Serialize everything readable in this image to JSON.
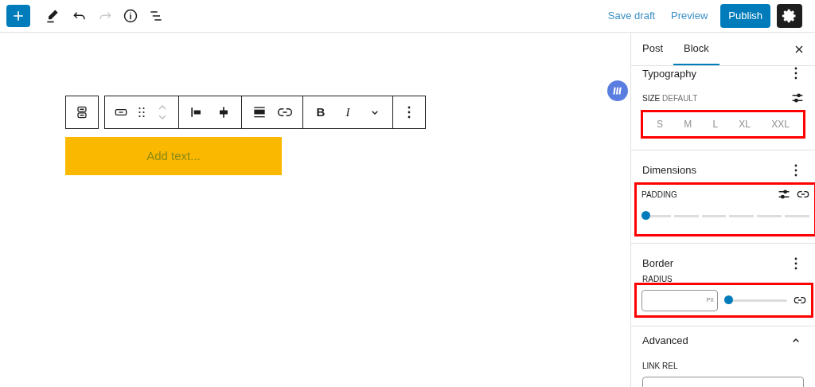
{
  "toolbar": {
    "save_draft": "Save draft",
    "preview": "Preview",
    "publish": "Publish",
    "redo_disabled": true
  },
  "editor": {
    "text_placeholder": "Add text..."
  },
  "block_toolbar": {
    "bold": "B",
    "italic": "I"
  },
  "sidebar": {
    "tabs": [
      {
        "label": "Post",
        "selected": false
      },
      {
        "label": "Block",
        "selected": true
      }
    ],
    "typography": {
      "title": "Typography",
      "size_label": "SIZE",
      "size_value": "DEFAULT",
      "sizes": [
        {
          "label": "S",
          "selected": false
        },
        {
          "label": "M",
          "selected": false
        },
        {
          "label": "L",
          "selected": false
        },
        {
          "label": "XL",
          "selected": false
        },
        {
          "label": "XXL",
          "selected": false
        }
      ]
    },
    "dimensions": {
      "title": "Dimensions",
      "padding": {
        "label": "PADDING",
        "level": 0
      }
    },
    "border": {
      "title": "Border",
      "radius_label": "RADIUS",
      "unit": "PX",
      "radius": {
        "level": 0
      }
    },
    "advanced": {
      "title": "Advanced",
      "expanded": true,
      "link_rel_label": "LINK REL"
    }
  }
}
